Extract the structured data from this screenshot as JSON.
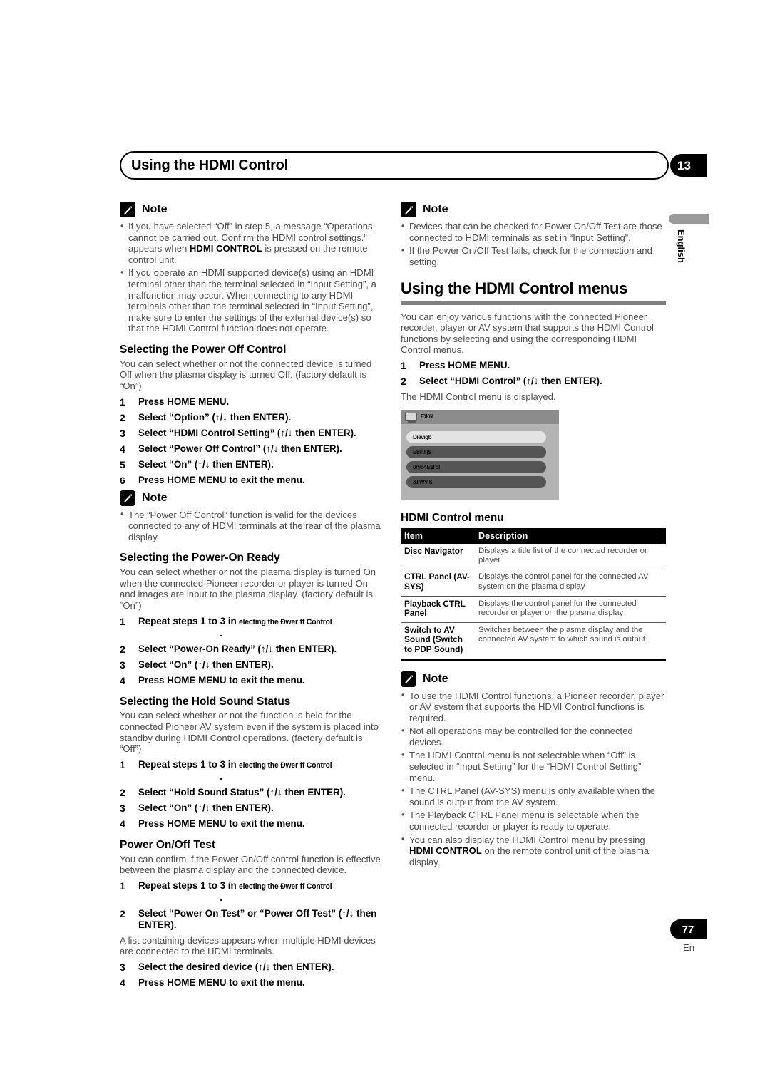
{
  "header": {
    "running_title": "Using the HDMI Control",
    "chapter_badge": "13"
  },
  "side_tab": {
    "language": "English"
  },
  "footer": {
    "page_number": "77",
    "language_code": "En"
  },
  "note_label": "Note",
  "left_column": {
    "note1": {
      "bullets": [
        {
          "pre": "If you have selected “Off” in step 5, a message “Operations cannot be carried out. Confirm the HDMI control settings.” appears when ",
          "bold": "HDMI CONTROL",
          "post": " is pressed on the remote control unit."
        },
        {
          "pre": "If you operate an HDMI supported device(s) using an HDMI terminal other than the terminal selected in “Input Setting”, a malfunction may occur. When connecting to any HDMI terminals other than the terminal selected in “Input Setting”, make sure to enter the settings of the external device(s) so that the HDMI Control function does not operate.",
          "bold": "",
          "post": ""
        }
      ]
    },
    "power_off_control": {
      "heading": "Selecting the Power Off Control",
      "body": "You can select whether or not the connected device is turned Off when the plasma display is turned Off. (factory default is “On”)",
      "steps": [
        {
          "num": "1",
          "text": "Press HOME MENU."
        },
        {
          "num": "2",
          "text": "Select “Option” (↑/↓ then ENTER)."
        },
        {
          "num": "3",
          "text": "Select “HDMI Control Setting” (↑/↓ then ENTER)."
        },
        {
          "num": "4",
          "text": "Select “Power Off Control” (↑/↓ then ENTER)."
        },
        {
          "num": "5",
          "text": "Select “On” (↑/↓ then ENTER)."
        },
        {
          "num": "6",
          "text": "Press HOME MENU to exit the menu."
        }
      ]
    },
    "note2": {
      "bullets": [
        {
          "pre": "The “Power Off Control” function is valid for the devices connected to any of HDMI terminals at the rear of the plasma display.",
          "bold": "",
          "post": ""
        }
      ]
    },
    "power_on_ready": {
      "heading": "Selecting the Power-On Ready",
      "body": "You can select whether or not the plasma display is turned On when the connected Pioneer recorder or player is turned On and images are input to the plasma display. (factory default is “On”)",
      "step1_prefix": "Repeat steps 1 to 3 in",
      "step1_glitch": "electing the Đwer ff Control",
      "step1_dot": ".",
      "steps": [
        {
          "num": "2",
          "text": "Select “Power-On Ready” (↑/↓ then ENTER)."
        },
        {
          "num": "3",
          "text": "Select “On” (↑/↓ then ENTER)."
        },
        {
          "num": "4",
          "text": "Press HOME MENU to exit the menu."
        }
      ]
    },
    "hold_sound_status": {
      "heading": "Selecting the Hold Sound Status",
      "body": "You can select whether or not the function is held for the connected Pioneer AV system even if the system is placed into standby during HDMI Control operations. (factory default is “Off”)",
      "step1_prefix": "Repeat steps 1 to 3 in",
      "step1_glitch": "electing the Đwer ff Control",
      "step1_dot": ".",
      "steps": [
        {
          "num": "2",
          "text": "Select “Hold Sound Status” (↑/↓ then ENTER)."
        },
        {
          "num": "3",
          "text": "Select “On” (↑/↓ then ENTER)."
        },
        {
          "num": "4",
          "text": "Press HOME MENU to exit the menu."
        }
      ]
    },
    "power_test": {
      "heading": "Power On/Off Test",
      "body": "You can confirm if the Power On/Off control function is effective between the plasma display and the connected device.",
      "step1_prefix": "Repeat steps 1 to 3 in",
      "step1_glitch": "electing the Đwer ff Control",
      "step1_dot": ".",
      "step2": {
        "num": "2",
        "text": "Select “Power On Test” or “Power Off Test” (↑/↓ then ENTER)."
      },
      "mid_body": "A list containing devices appears when multiple HDMI devices are connected to the HDMI terminals.",
      "steps_tail": [
        {
          "num": "3",
          "text": "Select the desired device (↑/↓ then ENTER)."
        },
        {
          "num": "4",
          "text": "Press HOME MENU to exit the menu."
        }
      ]
    }
  },
  "right_column": {
    "note1": {
      "bullets": [
        {
          "pre": "Devices that can be checked for Power On/Off Test are those connected to HDMI terminals as set in “Input Setting”.",
          "bold": "",
          "post": ""
        },
        {
          "pre": "If the Power On/Off Test fails, check for the connection and setting.",
          "bold": "",
          "post": ""
        }
      ]
    },
    "menus_section": {
      "heading": "Using the HDMI Control menus",
      "body": "You can enjoy various functions with the connected Pioneer recorder, player or AV system that supports the HDMI Control functions by selecting and using the corresponding HDMI Control menus.",
      "steps": [
        {
          "num": "1",
          "text": "Press HOME MENU."
        },
        {
          "num": "2",
          "text": "Select “HDMI Control” (↑/↓ then ENTER)."
        }
      ],
      "after_steps": "The HDMI Control menu is displayed."
    },
    "osd": {
      "title": "ЕЖ6І",
      "items": [
        {
          "label": "Dievigb",
          "selected": true
        },
        {
          "label": "E8ln/i)$",
          "selected": false
        },
        {
          "label": "0ryb4E$l'ol",
          "selected": false
        },
        {
          "label": "&IIWV $",
          "selected": false
        }
      ]
    },
    "table": {
      "title": "HDMI Control menu",
      "columns": [
        "Item",
        "Description"
      ],
      "rows": [
        {
          "item": "Disc Navigator",
          "description": "Displays a title list of the connected recorder or player"
        },
        {
          "item": "CTRL Panel (AV-SYS)",
          "description": "Displays the control panel for the connected AV system on the plasma display"
        },
        {
          "item": "Playback CTRL Panel",
          "description": "Displays the control panel for the connected recorder or player on the plasma display"
        },
        {
          "item": "Switch to AV Sound (Switch to PDP Sound)",
          "description": "Switches between the plasma display and the connected AV system to which sound is output"
        }
      ]
    },
    "note2": {
      "bullets": [
        {
          "pre": "To use the HDMI Control functions, a Pioneer recorder, player or AV system that supports the HDMI Control functions is required.",
          "bold": "",
          "post": ""
        },
        {
          "pre": "Not all operations may be controlled for the connected devices.",
          "bold": "",
          "post": ""
        },
        {
          "pre": "The HDMI Control menu is not selectable when “Off” is selected in “Input Setting” for the “HDMI Control Setting” menu.",
          "bold": "",
          "post": ""
        },
        {
          "pre": "The CTRL Panel (AV-SYS) menu is only available when the sound is output from the AV system.",
          "bold": "",
          "post": ""
        },
        {
          "pre": "The Playback CTRL Panel menu is selectable when the connected recorder or player is ready to operate.",
          "bold": "",
          "post": ""
        },
        {
          "pre": "You can also display the HDMI Control menu by pressing ",
          "bold": "HDMI CONTROL",
          "post": " on the remote control unit of the plasma display."
        }
      ]
    }
  }
}
